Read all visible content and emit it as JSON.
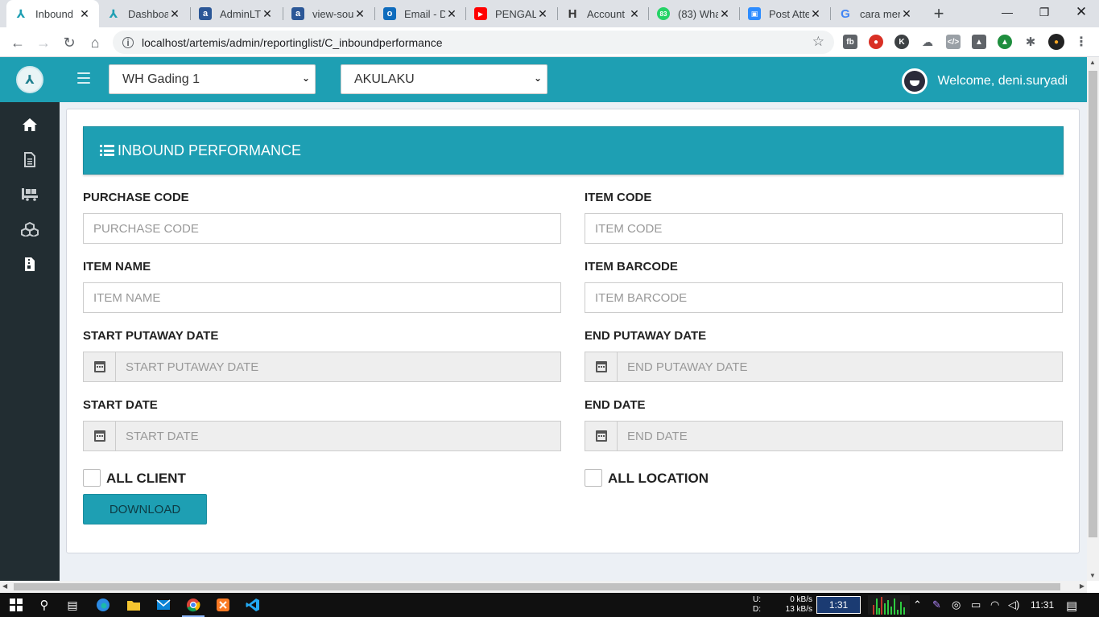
{
  "browser": {
    "tabs": [
      {
        "title": "Inbound",
        "favicon": "artemis-icon",
        "color": "#1e9fb3",
        "active": true
      },
      {
        "title": "Dashboar",
        "favicon": "artemis-icon",
        "color": "#1e9fb3"
      },
      {
        "title": "AdminLTE",
        "favicon": "a",
        "color": "#2b5797"
      },
      {
        "title": "view-sou",
        "favicon": "a",
        "color": "#2b5797"
      },
      {
        "title": "Email - D",
        "favicon": "o",
        "color": "#0f6cbd"
      },
      {
        "title": "PENGALA",
        "favicon": "▶",
        "color": "#ff0000"
      },
      {
        "title": "Account",
        "favicon": "H",
        "color": "#333333"
      },
      {
        "title": "(83) Wha",
        "favicon": "83",
        "color": "#25d366"
      },
      {
        "title": "Post Atte",
        "favicon": "▣",
        "color": "#2d8cff"
      },
      {
        "title": "cara men",
        "favicon": "G",
        "color": "#4285f4"
      }
    ],
    "url": "localhost/artemis/admin/reportinglist/C_inboundperformance"
  },
  "app": {
    "warehouse_select": "WH Gading 1",
    "client_select": "AKULAKU",
    "welcome": "Welcome, deni.suryadi",
    "accent_color": "#1e9fb3",
    "sidebar_icons": [
      "home-icon",
      "document-icon",
      "truck-icon",
      "cubes-icon",
      "file-zip-icon"
    ]
  },
  "panel": {
    "title": "INBOUND PERFORMANCE",
    "fields": {
      "purchase_code": {
        "label": "PURCHASE CODE",
        "placeholder": "PURCHASE CODE"
      },
      "item_code": {
        "label": "ITEM CODE",
        "placeholder": "ITEM CODE"
      },
      "item_name": {
        "label": "ITEM NAME",
        "placeholder": "ITEM NAME"
      },
      "item_barcode": {
        "label": "ITEM BARCODE",
        "placeholder": "ITEM BARCODE"
      },
      "start_putaway_date": {
        "label": "START PUTAWAY DATE",
        "placeholder": "START PUTAWAY DATE"
      },
      "end_putaway_date": {
        "label": "END PUTAWAY DATE",
        "placeholder": "END PUTAWAY DATE"
      },
      "start_date": {
        "label": "START DATE",
        "placeholder": "START DATE"
      },
      "end_date": {
        "label": "END DATE",
        "placeholder": "END DATE"
      }
    },
    "all_client": "ALL CLIENT",
    "all_location": "ALL LOCATION",
    "download": "DOWNLOAD"
  },
  "taskbar": {
    "net_up_label": "U:",
    "net_up": "0 kB/s",
    "net_down_label": "D:",
    "net_down": "13 kB/s",
    "timer": "1:31",
    "time": "11:31"
  }
}
